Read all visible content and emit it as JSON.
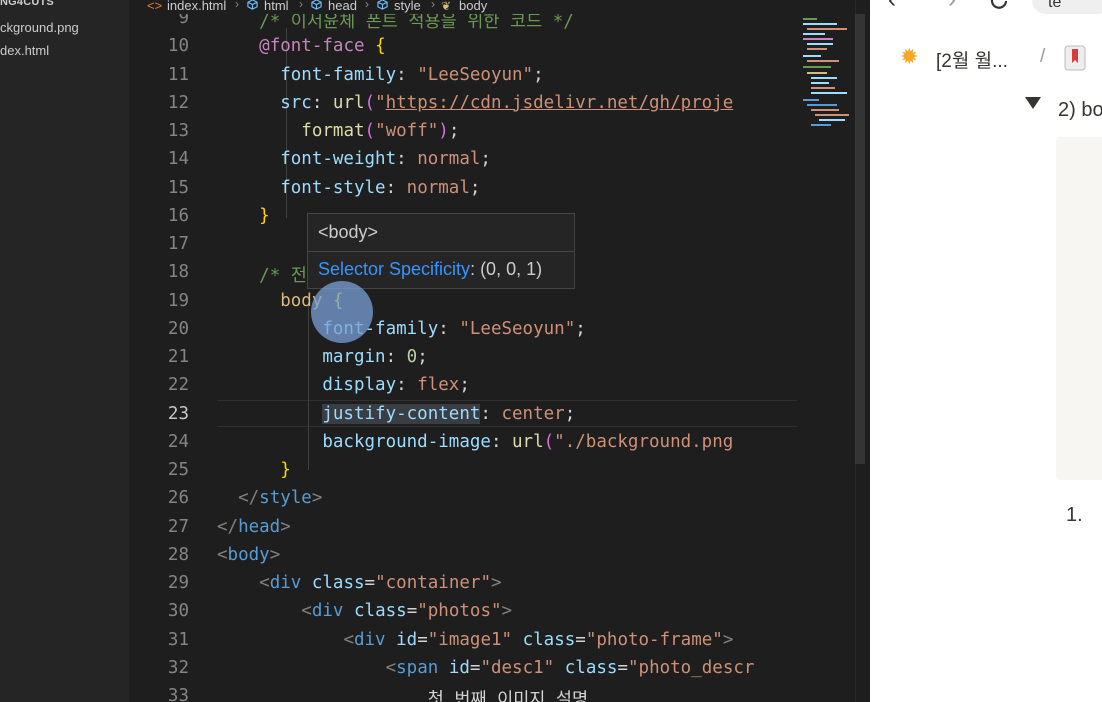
{
  "sidebar": {
    "section_title": "NG4CUTS",
    "files": [
      "ckground.png",
      "dex.html"
    ]
  },
  "breadcrumb": [
    "index.html",
    "html",
    "head",
    "style",
    "body"
  ],
  "editor": {
    "active_line": 23,
    "lines": [
      {
        "n": 9,
        "parts": [
          {
            "t": "    ",
            "c": "txt"
          },
          {
            "t": "/* 이서윤체 폰트 적용을 위한 코드 */",
            "c": "cmt"
          }
        ]
      },
      {
        "n": 10,
        "parts": [
          {
            "t": "    ",
            "c": "txt"
          },
          {
            "t": "@font-face",
            "c": "at"
          },
          {
            "t": " ",
            "c": "txt"
          },
          {
            "t": "{",
            "c": "brace"
          }
        ]
      },
      {
        "n": 11,
        "parts": [
          {
            "t": "      ",
            "c": "txt"
          },
          {
            "t": "font-family",
            "c": "prop"
          },
          {
            "t": ": ",
            "c": "punc"
          },
          {
            "t": "\"LeeSeoyun\"",
            "c": "str"
          },
          {
            "t": ";",
            "c": "punc"
          }
        ]
      },
      {
        "n": 12,
        "parts": [
          {
            "t": "      ",
            "c": "txt"
          },
          {
            "t": "src",
            "c": "prop"
          },
          {
            "t": ": ",
            "c": "punc"
          },
          {
            "t": "url",
            "c": "fn"
          },
          {
            "t": "(",
            "c": "paren"
          },
          {
            "t": "\"",
            "c": "str"
          },
          {
            "t": "https://cdn.jsdelivr.net/gh/proje",
            "c": "url"
          }
        ]
      },
      {
        "n": 13,
        "parts": [
          {
            "t": "        ",
            "c": "txt"
          },
          {
            "t": "format",
            "c": "fn"
          },
          {
            "t": "(",
            "c": "paren"
          },
          {
            "t": "\"woff\"",
            "c": "str"
          },
          {
            "t": ")",
            "c": "paren"
          },
          {
            "t": ";",
            "c": "punc"
          }
        ]
      },
      {
        "n": 14,
        "parts": [
          {
            "t": "      ",
            "c": "txt"
          },
          {
            "t": "font-weight",
            "c": "prop"
          },
          {
            "t": ": ",
            "c": "punc"
          },
          {
            "t": "normal",
            "c": "str"
          },
          {
            "t": ";",
            "c": "punc"
          }
        ]
      },
      {
        "n": 15,
        "parts": [
          {
            "t": "      ",
            "c": "txt"
          },
          {
            "t": "font-style",
            "c": "prop"
          },
          {
            "t": ": ",
            "c": "punc"
          },
          {
            "t": "normal",
            "c": "str"
          },
          {
            "t": ";",
            "c": "punc"
          }
        ]
      },
      {
        "n": 16,
        "parts": [
          {
            "t": "    ",
            "c": "txt"
          },
          {
            "t": "}",
            "c": "brace"
          }
        ]
      },
      {
        "n": 17,
        "parts": []
      },
      {
        "n": 18,
        "parts": [
          {
            "t": "    ",
            "c": "txt"
          },
          {
            "t": "/* 전체 페이지에 폰트 부여 */",
            "c": "cmt"
          }
        ]
      },
      {
        "n": 19,
        "parts": [
          {
            "t": "      ",
            "c": "txt"
          },
          {
            "t": "body",
            "c": "sel"
          },
          {
            "t": " ",
            "c": "txt"
          },
          {
            "t": "{",
            "c": "brace"
          }
        ]
      },
      {
        "n": 20,
        "parts": [
          {
            "t": "          ",
            "c": "txt"
          },
          {
            "t": "font-family",
            "c": "prop"
          },
          {
            "t": ": ",
            "c": "punc"
          },
          {
            "t": "\"LeeSeoyun\"",
            "c": "str"
          },
          {
            "t": ";",
            "c": "punc"
          }
        ]
      },
      {
        "n": 21,
        "parts": [
          {
            "t": "          ",
            "c": "txt"
          },
          {
            "t": "margin",
            "c": "prop"
          },
          {
            "t": ": ",
            "c": "punc"
          },
          {
            "t": "0",
            "c": "num"
          },
          {
            "t": ";",
            "c": "punc"
          }
        ]
      },
      {
        "n": 22,
        "parts": [
          {
            "t": "          ",
            "c": "txt"
          },
          {
            "t": "display",
            "c": "prop"
          },
          {
            "t": ": ",
            "c": "punc"
          },
          {
            "t": "flex",
            "c": "str"
          },
          {
            "t": ";",
            "c": "punc"
          }
        ]
      },
      {
        "n": 23,
        "parts": [
          {
            "t": "          ",
            "c": "txt"
          },
          {
            "t": "justify-content",
            "c": "prop",
            "hl": true
          },
          {
            "t": ": ",
            "c": "punc"
          },
          {
            "t": "center",
            "c": "str"
          },
          {
            "t": ";",
            "c": "punc"
          }
        ]
      },
      {
        "n": 24,
        "parts": [
          {
            "t": "          ",
            "c": "txt"
          },
          {
            "t": "background-image",
            "c": "prop"
          },
          {
            "t": ": ",
            "c": "punc"
          },
          {
            "t": "url",
            "c": "fn"
          },
          {
            "t": "(",
            "c": "paren"
          },
          {
            "t": "\"./background.png",
            "c": "str"
          }
        ]
      },
      {
        "n": 25,
        "parts": [
          {
            "t": "      ",
            "c": "txt"
          },
          {
            "t": "}",
            "c": "brace"
          }
        ]
      },
      {
        "n": 26,
        "parts": [
          {
            "t": "  ",
            "c": "txt"
          },
          {
            "t": "</",
            "c": "ang"
          },
          {
            "t": "style",
            "c": "tag"
          },
          {
            "t": ">",
            "c": "ang"
          }
        ]
      },
      {
        "n": 27,
        "parts": [
          {
            "t": "</",
            "c": "ang"
          },
          {
            "t": "head",
            "c": "tag"
          },
          {
            "t": ">",
            "c": "ang"
          }
        ]
      },
      {
        "n": 28,
        "parts": [
          {
            "t": "<",
            "c": "ang"
          },
          {
            "t": "body",
            "c": "tag"
          },
          {
            "t": ">",
            "c": "ang"
          }
        ]
      },
      {
        "n": 29,
        "parts": [
          {
            "t": "    ",
            "c": "txt"
          },
          {
            "t": "<",
            "c": "ang"
          },
          {
            "t": "div",
            "c": "tag"
          },
          {
            "t": " ",
            "c": "txt"
          },
          {
            "t": "class",
            "c": "attr"
          },
          {
            "t": "=",
            "c": "punc"
          },
          {
            "t": "\"container\"",
            "c": "str"
          },
          {
            "t": ">",
            "c": "ang"
          }
        ]
      },
      {
        "n": 30,
        "parts": [
          {
            "t": "        ",
            "c": "txt"
          },
          {
            "t": "<",
            "c": "ang"
          },
          {
            "t": "div",
            "c": "tag"
          },
          {
            "t": " ",
            "c": "txt"
          },
          {
            "t": "class",
            "c": "attr"
          },
          {
            "t": "=",
            "c": "punc"
          },
          {
            "t": "\"photos\"",
            "c": "str"
          },
          {
            "t": ">",
            "c": "ang"
          }
        ]
      },
      {
        "n": 31,
        "parts": [
          {
            "t": "            ",
            "c": "txt"
          },
          {
            "t": "<",
            "c": "ang"
          },
          {
            "t": "div",
            "c": "tag"
          },
          {
            "t": " ",
            "c": "txt"
          },
          {
            "t": "id",
            "c": "attr"
          },
          {
            "t": "=",
            "c": "punc"
          },
          {
            "t": "\"image1\"",
            "c": "str"
          },
          {
            "t": " ",
            "c": "txt"
          },
          {
            "t": "class",
            "c": "attr"
          },
          {
            "t": "=",
            "c": "punc"
          },
          {
            "t": "\"photo-frame\"",
            "c": "str"
          },
          {
            "t": ">",
            "c": "ang"
          }
        ]
      },
      {
        "n": 32,
        "parts": [
          {
            "t": "                ",
            "c": "txt"
          },
          {
            "t": "<",
            "c": "ang"
          },
          {
            "t": "span",
            "c": "tag"
          },
          {
            "t": " ",
            "c": "txt"
          },
          {
            "t": "id",
            "c": "attr"
          },
          {
            "t": "=",
            "c": "punc"
          },
          {
            "t": "\"desc1\"",
            "c": "str"
          },
          {
            "t": " ",
            "c": "txt"
          },
          {
            "t": "class",
            "c": "attr"
          },
          {
            "t": "=",
            "c": "punc"
          },
          {
            "t": "\"photo_descr",
            "c": "str"
          }
        ]
      },
      {
        "n": 33,
        "parts": [
          {
            "t": "                    ",
            "c": "txt"
          },
          {
            "t": "첫 번째 이미지 설명",
            "c": "txt"
          }
        ]
      }
    ]
  },
  "hover": {
    "tag": "<body>",
    "specificity_label": "Selector Specificity",
    "specificity_value": ": (0, 0, 1)"
  },
  "browser": {
    "address_text": "te",
    "breadcrumb_1": "[2월 월...",
    "breadcrumb_sep": "/",
    "toggle_text": "2) bo",
    "list_number": "1."
  },
  "colors": {
    "editor_bg": "#1e1e1e",
    "sidebar_bg": "#252526",
    "link": "#3794ff"
  }
}
